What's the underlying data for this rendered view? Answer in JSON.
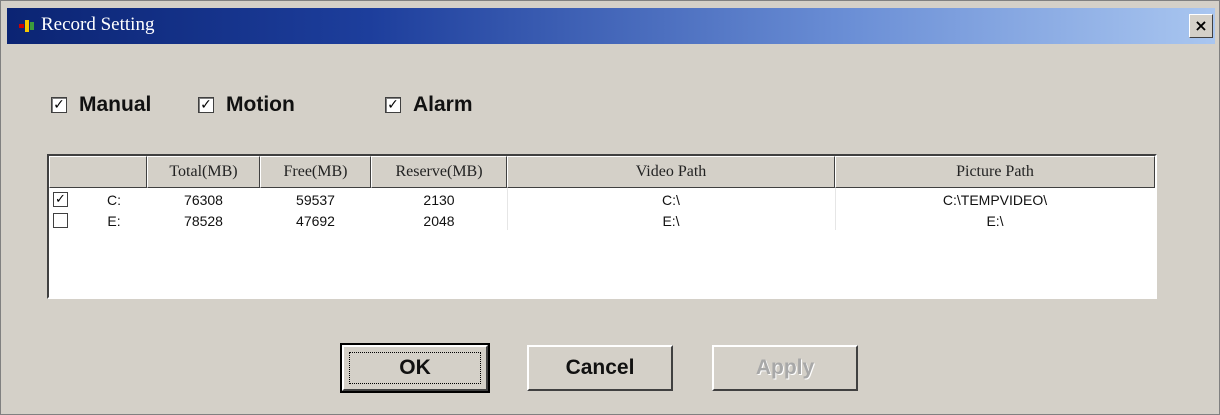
{
  "window": {
    "title": "Record Setting",
    "close_symbol": "×"
  },
  "options": [
    {
      "label": "Manual",
      "checked": true
    },
    {
      "label": "Motion",
      "checked": true
    },
    {
      "label": "Alarm",
      "checked": true
    }
  ],
  "table": {
    "columns": [
      "",
      "Total(MB)",
      "Free(MB)",
      "Reserve(MB)",
      "Video Path",
      "Picture Path"
    ],
    "rows": [
      {
        "checked": true,
        "drive": "C:",
        "total": "76308",
        "free": "59537",
        "reserve": "2130",
        "video_path": "C:\\",
        "picture_path": "C:\\TEMPVIDEO\\"
      },
      {
        "checked": false,
        "drive": "E:",
        "total": "78528",
        "free": "47692",
        "reserve": "2048",
        "video_path": "E:\\",
        "picture_path": "E:\\"
      }
    ]
  },
  "buttons": {
    "ok": "OK",
    "cancel": "Cancel",
    "apply": "Apply"
  },
  "check_mark": "✓"
}
